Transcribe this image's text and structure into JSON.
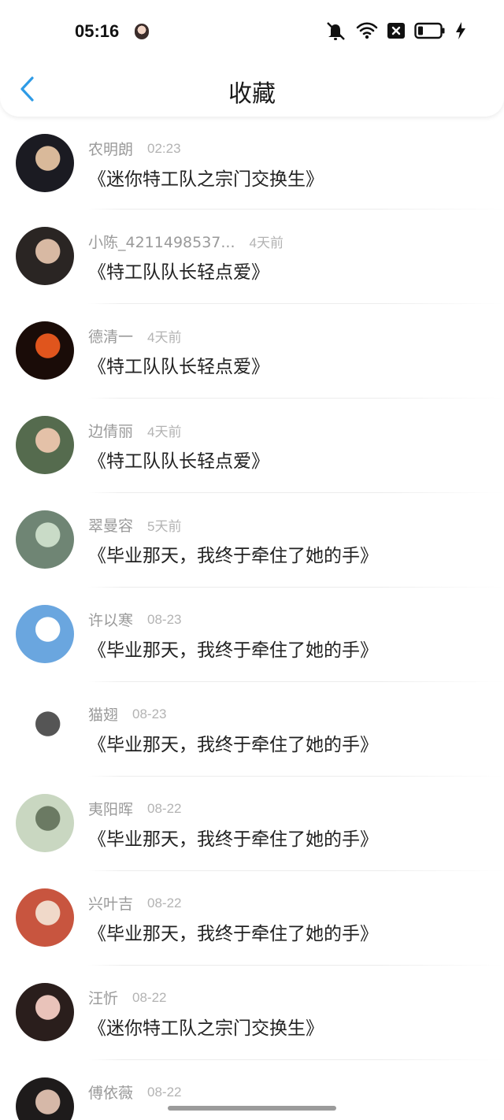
{
  "status_bar": {
    "time": "05:16",
    "icons": [
      "mute-bell-icon",
      "wifi-icon",
      "close-box-icon",
      "battery-icon",
      "charging-bolt-icon"
    ]
  },
  "nav": {
    "title": "收藏",
    "back_icon": "chevron-left-icon",
    "accent_color": "#2e9be6"
  },
  "favorites": [
    {
      "name": "农明朗",
      "time": "02:23",
      "title": "《迷你特工队之宗门交换生》",
      "avatar_colors": [
        "#1b1b22",
        "#d9b99a"
      ]
    },
    {
      "name": "小陈_4211498537...",
      "time": "4天前",
      "title": "《特工队队长轻点爱》",
      "avatar_colors": [
        "#2a2523",
        "#d8b9a3"
      ]
    },
    {
      "name": "德清一",
      "time": "4天前",
      "title": "《特工队队长轻点爱》",
      "avatar_colors": [
        "#1a0c08",
        "#e0551d"
      ]
    },
    {
      "name": "边倩丽",
      "time": "4天前",
      "title": "《特工队队长轻点爱》",
      "avatar_colors": [
        "#556b4e",
        "#e4c1a8"
      ]
    },
    {
      "name": "翠曼容",
      "time": "5天前",
      "title": "《毕业那天，我终于牵住了她的手》",
      "avatar_colors": [
        "#6f8574",
        "#c9dbc7"
      ]
    },
    {
      "name": "许以寒",
      "time": "08-23",
      "title": "《毕业那天，我终于牵住了她的手》",
      "avatar_colors": [
        "#6aa6df",
        "#ffffff"
      ]
    },
    {
      "name": "猫翅",
      "time": "08-23",
      "title": "《毕业那天，我终于牵住了她的手》",
      "avatar_colors": [
        "#ffffff",
        "#555555"
      ]
    },
    {
      "name": "夷阳晖",
      "time": "08-22",
      "title": "《毕业那天，我终于牵住了她的手》",
      "avatar_colors": [
        "#c9d7c1",
        "#6b7a63"
      ]
    },
    {
      "name": "兴叶吉",
      "time": "08-22",
      "title": "《毕业那天，我终于牵住了她的手》",
      "avatar_colors": [
        "#c8553f",
        "#f0d9c9"
      ]
    },
    {
      "name": "汪忻",
      "time": "08-22",
      "title": "《迷你特工队之宗门交换生》",
      "avatar_colors": [
        "#2a1e1c",
        "#e9c3ba"
      ]
    },
    {
      "name": "傅依薇",
      "time": "08-22",
      "title": "",
      "avatar_colors": [
        "#1e1b1b",
        "#d6b8a8"
      ]
    }
  ]
}
